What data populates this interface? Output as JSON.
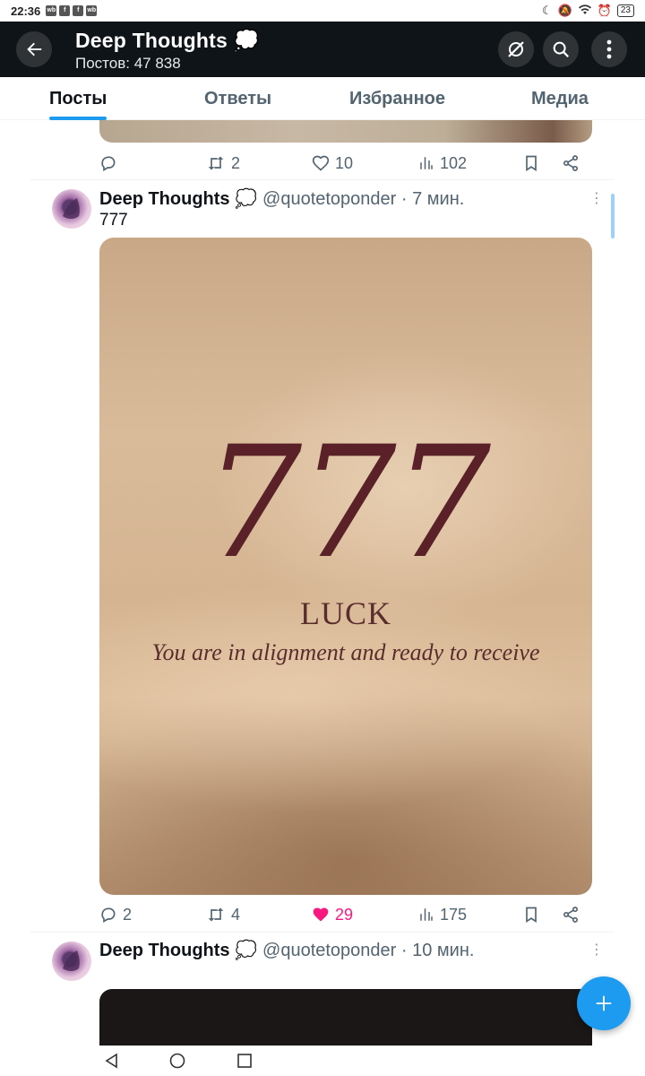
{
  "status_bar": {
    "time": "22:36",
    "notif_icons": [
      "wb",
      "f",
      "f",
      "wb"
    ],
    "battery": "23"
  },
  "header": {
    "title": "Deep Thoughts 💭",
    "subtitle": "Постов: 47 838"
  },
  "tabs": [
    {
      "label": "Посты",
      "active": true
    },
    {
      "label": "Ответы",
      "active": false
    },
    {
      "label": "Избранное",
      "active": false
    },
    {
      "label": "Медиа",
      "active": false
    }
  ],
  "prev_post": {
    "actions": {
      "reply": "",
      "repost": "2",
      "like": "10",
      "views": "102"
    }
  },
  "post1": {
    "name": "Deep Thoughts 💭",
    "handle": "@quotetoponder · 7 мин.",
    "text": "777",
    "image_text": {
      "number": "777",
      "word": "LUCK",
      "sentence": "You are in alignment and ready to receive"
    },
    "actions": {
      "reply": "2",
      "repost": "4",
      "like": "29",
      "views": "175"
    },
    "liked": true
  },
  "post2": {
    "name": "Deep Thoughts 💭",
    "handle": "@quotetoponder · 10 мин."
  },
  "colors": {
    "accent": "#1d9bf0",
    "like": "#f91880",
    "header_bg": "#0f1419",
    "muted": "#536471"
  }
}
